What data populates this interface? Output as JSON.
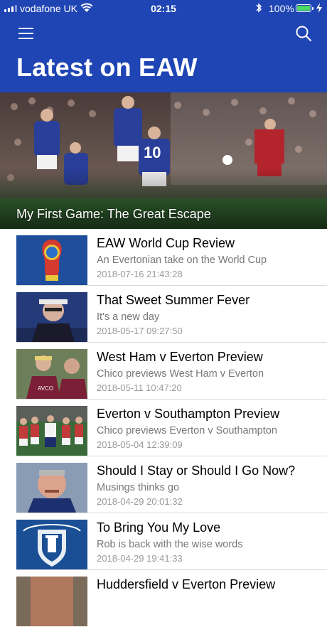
{
  "status_bar": {
    "carrier": "vodafone UK",
    "time": "02:15",
    "battery": "100%",
    "signal_bars_filled": 3,
    "signal_bars_total": 4
  },
  "header": {
    "title": "Latest on EAW"
  },
  "featured": {
    "title": "My First Game: The Great Escape"
  },
  "articles": [
    {
      "title": "EAW World Cup Review",
      "subtitle": "An Evertonian take on the World Cup",
      "date": "2018-07-16 21:43:28"
    },
    {
      "title": "That Sweet Summer Fever",
      "subtitle": "It's a new day",
      "date": "2018-05-17 09:27:50"
    },
    {
      "title": "West Ham v Everton Preview",
      "subtitle": "Chico previews West Ham v Everton",
      "date": "2018-05-11 10:47:20"
    },
    {
      "title": "Everton v Southampton Preview",
      "subtitle": "Chico previews Everton v Southampton",
      "date": "2018-05-04 12:39:09"
    },
    {
      "title": "Should I Stay or Should I Go Now?",
      "subtitle": "Musings thinks go",
      "date": "2018-04-29 20:01:32"
    },
    {
      "title": "To Bring You My Love",
      "subtitle": "Rob is back with the wise words",
      "date": "2018-04-29 19:41:33"
    },
    {
      "title": "Huddersfield v Everton Preview",
      "subtitle": "",
      "date": ""
    }
  ],
  "colors": {
    "brand_blue": "#1f45b4",
    "separator": "#d9d9d9",
    "subtitle_gray": "#777777",
    "battery_green": "#4cd964"
  }
}
